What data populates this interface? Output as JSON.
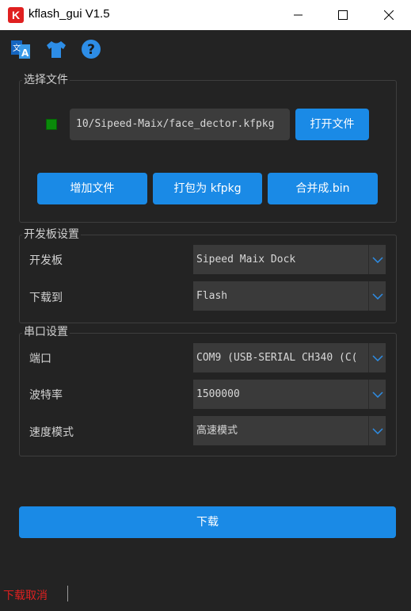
{
  "window": {
    "logo": "K",
    "title": "kflash_gui V1.5"
  },
  "toolbar": {
    "icons": [
      "translate-icon",
      "shirt-icon",
      "help-icon"
    ]
  },
  "file_group": {
    "title": "选择文件",
    "path": "10/Sipeed-Maix/face_dector.kfpkg",
    "open_button": "打开文件",
    "add_button": "增加文件",
    "pack_button": "打包为 kfpkg",
    "merge_button": "合并成.bin"
  },
  "board_group": {
    "title": "开发板设置",
    "board_label": "开发板",
    "board_value": "Sipeed Maix Dock",
    "target_label": "下载到",
    "target_value": "Flash"
  },
  "serial_group": {
    "title": "串口设置",
    "port_label": "端口",
    "port_value": "COM9 (USB-SERIAL CH340 (C(",
    "baud_label": "波特率",
    "baud_value": "1500000",
    "speed_label": "速度模式",
    "speed_value": "高速模式"
  },
  "download_button": "下载",
  "status_text": "下载取消",
  "colors": {
    "accent": "#1a8ae6",
    "status_error": "#e02020",
    "indicator": "#0a8a0a",
    "background": "#232323"
  }
}
